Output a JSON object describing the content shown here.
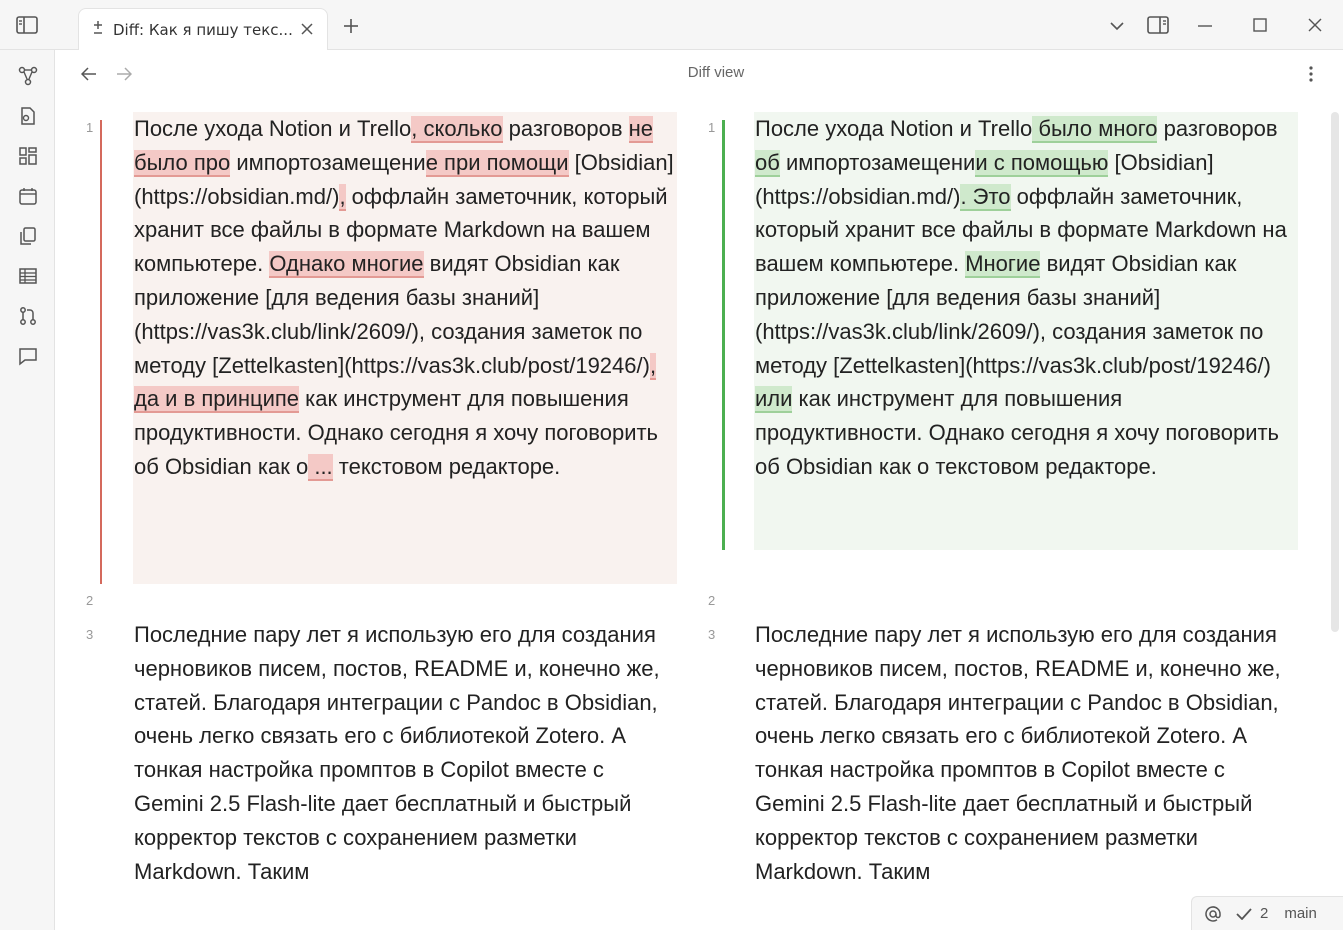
{
  "tab": {
    "title": "Diff: Как я пишу текс..."
  },
  "header": {
    "view_title": "Diff view"
  },
  "left": {
    "p1": [
      {
        "t": "После ухода Notion и Trello"
      },
      {
        "t": ", сколько",
        "type": "del"
      },
      {
        "t": " разговоров "
      },
      {
        "t": "не было про",
        "type": "del"
      },
      {
        "t": " импортозамещени"
      },
      {
        "t": "е при помощи",
        "type": "del"
      },
      {
        "t": " [Obsidian](https://obsidian.md/)"
      },
      {
        "t": ",",
        "type": "del"
      },
      {
        "t": " оффлайн заметочник, который хранит все файлы в формате Markdown на вашем компьютере. "
      },
      {
        "t": "Однако многие",
        "type": "del"
      },
      {
        "t": " видят Obsidian как приложение [для ведения базы знаний](https://vas3k.club/link/2609/), создания заметок по методу [Zettelkasten](https://vas3k.club/post/19246/)"
      },
      {
        "t": ", да и в принципе",
        "type": "del"
      },
      {
        "t": " как инструмент для повышения продуктивности. Однако сегодня я хочу поговорить об Obsidian как о"
      },
      {
        "t": " ...",
        "type": "del"
      },
      {
        "t": " текстовом редакторе."
      }
    ],
    "p3": "Последние пару лет я использую его для создания черновиков писем, постов, README и, конечно же, статей. Благодаря интеграции с Pandoc в Obsidian, очень легко связать его с библиотекой Zotero. А тонкая настройка промптов в Copilot вместе с Gemini 2.5 Flash-lite дает бесплатный и быстрый корректор текстов с сохранением разметки Markdown. Таким"
  },
  "right": {
    "p1": [
      {
        "t": "После ухода Notion и Trello"
      },
      {
        "t": " было много",
        "type": "add"
      },
      {
        "t": " разговоров "
      },
      {
        "t": "об",
        "type": "add"
      },
      {
        "t": " импортозамещени"
      },
      {
        "t": "и с помощью",
        "type": "add"
      },
      {
        "t": " [Obsidian](https://obsidian.md/)"
      },
      {
        "t": ". Это",
        "type": "add"
      },
      {
        "t": " оффлайн заметочник, который хранит все файлы в формате Markdown на вашем компьютере. "
      },
      {
        "t": "Многие",
        "type": "add"
      },
      {
        "t": " видят Obsidian как приложение [для ведения базы знаний](https://vas3k.club/link/2609/), создания заметок по методу [Zettelkasten](https://vas3k.club/post/19246/)"
      },
      {
        "t": " или",
        "type": "add"
      },
      {
        "t": " как инструмент для повышения продуктивности. Однако сегодня я хочу поговорить об Obsidian как о текстовом редакторе."
      }
    ],
    "p3": "Последние пару лет я использую его для создания черновиков писем, постов, README и, конечно же, статей. Благодаря интеграции с Pandoc в Obsidian, очень легко связать его с библиотекой Zotero. А тонкая настройка промптов в Copilot вместе с Gemini 2.5 Flash-lite дает бесплатный и быстрый корректор текстов с сохранением разметки Markdown. Таким"
  },
  "line_numbers": {
    "l1": "1",
    "l2": "2",
    "l3": "3"
  },
  "status": {
    "sync_count": "2",
    "branch": "main"
  },
  "icons": {
    "sidebar_toggle": "sidebar-left-icon",
    "new_tab": "plus-icon",
    "tab_list": "chevron-down-icon",
    "right_sidebar": "sidebar-right-icon",
    "minimize": "minimize-icon",
    "maximize": "maximize-icon",
    "close": "close-icon"
  }
}
